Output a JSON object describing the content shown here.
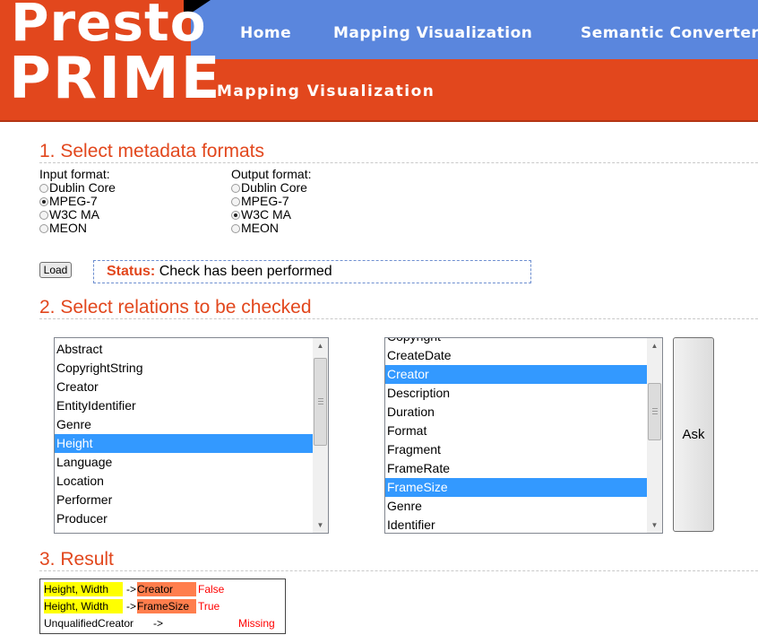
{
  "logo": {
    "line1": "Presto",
    "line2": "PRIME"
  },
  "nav": {
    "home": "Home",
    "mapping": "Mapping Visualization",
    "semantic": "Semantic Converter"
  },
  "page_subtitle": "Mapping  Visualization",
  "section1": {
    "title": "1. Select metadata formats",
    "input_label": "Input format:",
    "output_label": "Output format:",
    "input_options": [
      "Dublin Core",
      "MPEG-7",
      "W3C MA",
      "MEON"
    ],
    "input_selected": "MPEG-7",
    "output_options": [
      "Dublin Core",
      "MPEG-7",
      "W3C MA",
      "MEON"
    ],
    "output_selected": "W3C MA",
    "load_label": "Load",
    "status_key": "Status:",
    "status_text": "Check has been performed"
  },
  "section2": {
    "title": "2. Select relations to be checked",
    "left_list": [
      "Abstract",
      "CopyrightString",
      "Creator",
      "EntityIdentifier",
      "Genre",
      "Height",
      "Language",
      "Location",
      "Performer",
      "Producer"
    ],
    "left_selected": [
      "Height"
    ],
    "right_list": [
      "Copyright",
      "CreateDate",
      "Creator",
      "Description",
      "Duration",
      "Format",
      "Fragment",
      "FrameRate",
      "FrameSize",
      "Genre",
      "Identifier"
    ],
    "right_selected": [
      "Creator",
      "FrameSize"
    ],
    "ask_label": "Ask"
  },
  "section3": {
    "title": "3. Result",
    "rows": [
      {
        "source": "Height, Width",
        "arrow": "->",
        "target": "Creator",
        "result": "False"
      },
      {
        "source": "Height, Width",
        "arrow": "->",
        "target": "FrameSize",
        "result": "True"
      },
      {
        "source": "UnqualifiedCreator",
        "arrow": "->",
        "target": "",
        "result": "Missing"
      }
    ]
  },
  "colors": {
    "brand_orange": "#e2471d",
    "nav_blue": "#5a86dd",
    "selection_blue": "#3399ff",
    "highlight_yellow": "#ffff00",
    "highlight_orange": "#ff7e4d"
  }
}
